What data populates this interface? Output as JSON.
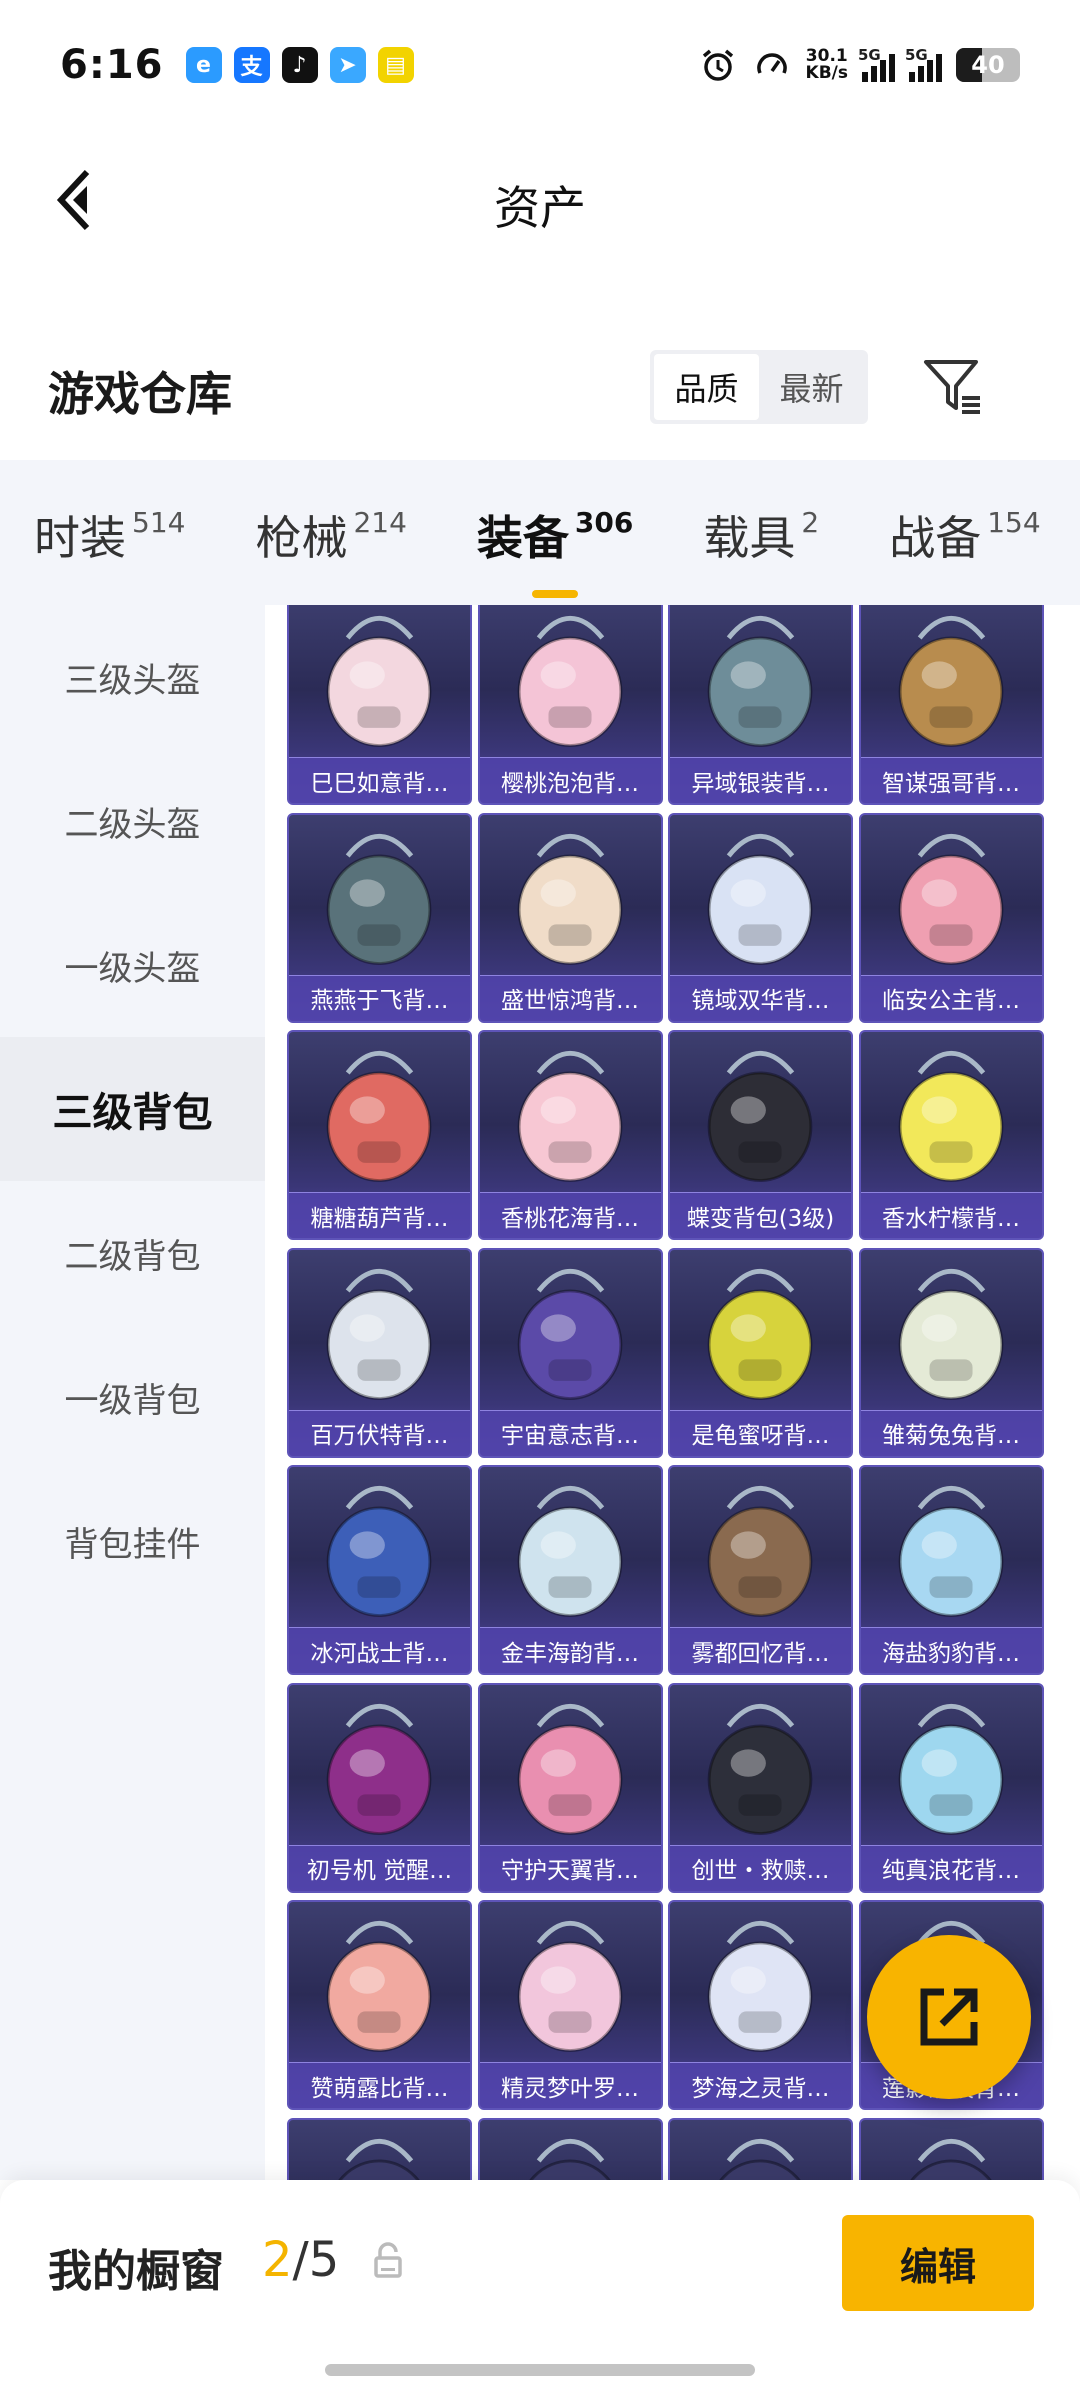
{
  "status_bar": {
    "time": "6:16",
    "net_speed_value": "30.1",
    "net_speed_unit": "KB/s",
    "signal_label_1": "5G",
    "signal_label_2": "5G",
    "battery": "40",
    "apps": [
      {
        "icon": "browser-icon",
        "color": "#2b9bff",
        "glyph": "e"
      },
      {
        "icon": "alipay-icon",
        "color": "#1677ff",
        "glyph": "支"
      },
      {
        "icon": "tiktok-icon",
        "color": "#111111",
        "glyph": "♪"
      },
      {
        "icon": "send-icon",
        "color": "#3aa8ff",
        "glyph": "➤"
      },
      {
        "icon": "yellow-app-icon",
        "color": "#f2d300",
        "glyph": "▤"
      }
    ]
  },
  "header": {
    "title": "资产"
  },
  "section": {
    "title": "游戏仓库",
    "sort_options": [
      "品质",
      "最新"
    ],
    "active_sort": "品质"
  },
  "tabs": [
    {
      "label": "时装",
      "count": "514"
    },
    {
      "label": "枪械",
      "count": "214"
    },
    {
      "label": "装备",
      "count": "306",
      "active": true
    },
    {
      "label": "载具",
      "count": "2"
    },
    {
      "label": "战备",
      "count": "154"
    }
  ],
  "categories": [
    {
      "label": "三级头盔"
    },
    {
      "label": "二级头盔"
    },
    {
      "label": "一级头盔"
    },
    {
      "label": "三级背包",
      "active": true
    },
    {
      "label": "二级背包"
    },
    {
      "label": "一级背包"
    },
    {
      "label": "背包挂件"
    }
  ],
  "items": [
    {
      "label": "巳巳如意背…",
      "color": "#f3d7df"
    },
    {
      "label": "樱桃泡泡背…",
      "color": "#f4c4d6"
    },
    {
      "label": "异域银装背…",
      "color": "#6e8d99"
    },
    {
      "label": "智谋强哥背…",
      "color": "#b88c4e"
    },
    {
      "label": "燕燕于飞背…",
      "color": "#59727a"
    },
    {
      "label": "盛世惊鸿背…",
      "color": "#f0dcc8"
    },
    {
      "label": "镜域双华背…",
      "color": "#d9e2f4"
    },
    {
      "label": "临安公主背…",
      "color": "#ef9fb1"
    },
    {
      "label": "糖糖葫芦背…",
      "color": "#e06a62"
    },
    {
      "label": "香桃花海背…",
      "color": "#f7c7d3"
    },
    {
      "label": "蝶变背包(3级)",
      "color": "#2d2d36"
    },
    {
      "label": "香水柠檬背…",
      "color": "#f2e85a"
    },
    {
      "label": "百万伏特背…",
      "color": "#dde3ec"
    },
    {
      "label": "宇宙意志背…",
      "color": "#5b4aa8"
    },
    {
      "label": "是龟蜜呀背…",
      "color": "#d7d33c"
    },
    {
      "label": "雏菊兔兔背…",
      "color": "#e4ead6"
    },
    {
      "label": "冰河战士背…",
      "color": "#3d5fb8"
    },
    {
      "label": "金丰海韵背…",
      "color": "#cfe3ee"
    },
    {
      "label": "雾都回忆背…",
      "color": "#8a6a4f"
    },
    {
      "label": "海盐豹豹背…",
      "color": "#a8d8f2"
    },
    {
      "label": "初号机 觉醒…",
      "color": "#8e2f8a"
    },
    {
      "label": "守护天翼背…",
      "color": "#e98fb0"
    },
    {
      "label": "创世・救赎…",
      "color": "#2d2f3a"
    },
    {
      "label": "纯真浪花背…",
      "color": "#9ed7ef"
    },
    {
      "label": "赞萌露比背…",
      "color": "#f1a9a0"
    },
    {
      "label": "精灵梦叶罗…",
      "color": "#f2c6dc"
    },
    {
      "label": "梦海之灵背…",
      "color": "#dfe4f5"
    },
    {
      "label": "莲影清波背…",
      "color": "#7fc9e0"
    },
    {
      "label": "",
      "color": "#3b3b6a"
    },
    {
      "label": "",
      "color": "#3b3b6a"
    },
    {
      "label": "",
      "color": "#3b3b6a"
    },
    {
      "label": "",
      "color": "#3b3b6a"
    }
  ],
  "showcase": {
    "title": "我的橱窗",
    "current": "2",
    "separator": "/",
    "total": "5",
    "edit_label": "编辑"
  },
  "colors": {
    "accent": "#f8b400",
    "card_label_bg": "#5042aa"
  }
}
